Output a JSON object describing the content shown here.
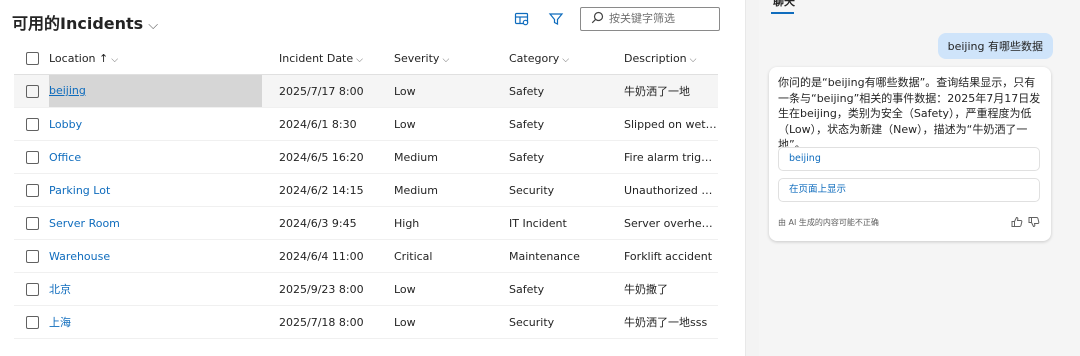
{
  "header": {
    "title": "可用的Incidents"
  },
  "search": {
    "placeholder": "按关键字筛选"
  },
  "table": {
    "columns": [
      "Location",
      "Incident Date",
      "Severity",
      "Category",
      "Description"
    ],
    "sort_arrow": "↑",
    "rows": [
      {
        "location": "beijing",
        "date": "2025/7/17 8:00",
        "severity": "Low",
        "category": "Safety",
        "description": "牛奶洒了一地"
      },
      {
        "location": "Lobby",
        "date": "2024/6/1 8:30",
        "severity": "Low",
        "category": "Safety",
        "description": "Slipped on wet flo"
      },
      {
        "location": "Office",
        "date": "2024/6/5 16:20",
        "severity": "Medium",
        "category": "Safety",
        "description": "Fire alarm triggere"
      },
      {
        "location": "Parking Lot",
        "date": "2024/6/2 14:15",
        "severity": "Medium",
        "category": "Security",
        "description": "Unauthorized acc.."
      },
      {
        "location": "Server Room",
        "date": "2024/6/3 9:45",
        "severity": "High",
        "category": "IT Incident",
        "description": "Server overheating"
      },
      {
        "location": "Warehouse",
        "date": "2024/6/4 11:00",
        "severity": "Critical",
        "category": "Maintenance",
        "description": "Forklift accident"
      },
      {
        "location": "北京",
        "date": "2025/9/23 8:00",
        "severity": "Low",
        "category": "Safety",
        "description": "牛奶撒了"
      },
      {
        "location": "上海",
        "date": "2025/7/18 8:00",
        "severity": "Low",
        "category": "Security",
        "description": "牛奶洒了一地sss"
      }
    ]
  },
  "chat": {
    "tab_label": "聊天",
    "user_message": "beijing 有哪些数据",
    "bot_message": "你问的是“beijing有哪些数据”。查询结果显示，只有一条与“beijing”相关的事件数据：2025年7月17日发生在beijing，类别为安全（Safety），严重程度为低（Low），状态为新建（New），描述为“牛奶洒了一地”。",
    "reference_label": "beijing",
    "show_on_page_label": "在页面上显示",
    "disclaimer": "由 AI 生成的内容可能不正确"
  },
  "colors": {
    "accent": "#0f6cbd",
    "user_bubble": "#cfe4fa",
    "selected_highlight": "#d6d6d6"
  }
}
